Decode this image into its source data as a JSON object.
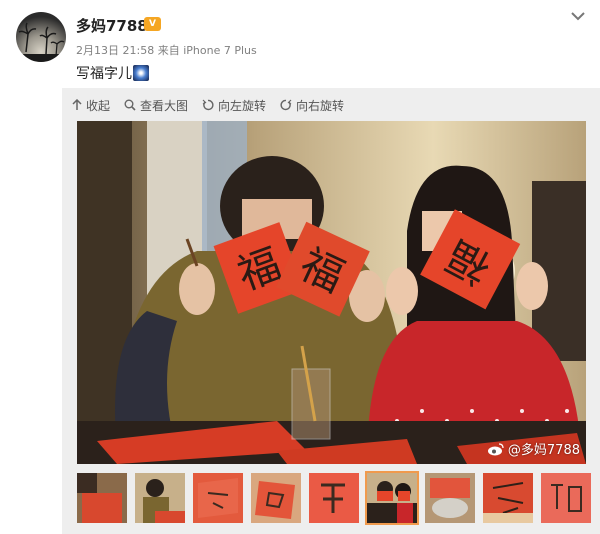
{
  "post": {
    "username": "多妈7788",
    "vip_badge": "vip",
    "date": "2月13日 21:58",
    "source_prefix": "来自",
    "device": "iPhone 7 Plus",
    "text": "写福字儿"
  },
  "toolbar": {
    "collapse": "收起",
    "view_large": "查看大图",
    "rotate_left": "向左旋转",
    "rotate_right": "向右旋转"
  },
  "photo": {
    "watermark": "@多妈7788",
    "left_paper_char": "福",
    "right_paper_char": "福",
    "girl_paper_char": "福"
  },
  "thumbnails": {
    "count": 9,
    "active_index": 5,
    "accent": "#f09a4d"
  },
  "icons": [
    "chevron-down-icon",
    "zoom-in-icon",
    "search-icon",
    "rotate-left-icon",
    "rotate-right-icon",
    "weibo-icon",
    "sparkle-icon"
  ],
  "colors": {
    "paper_red": "#e5452a",
    "sweater_red": "#c8262a",
    "meta_gray": "#808080"
  }
}
